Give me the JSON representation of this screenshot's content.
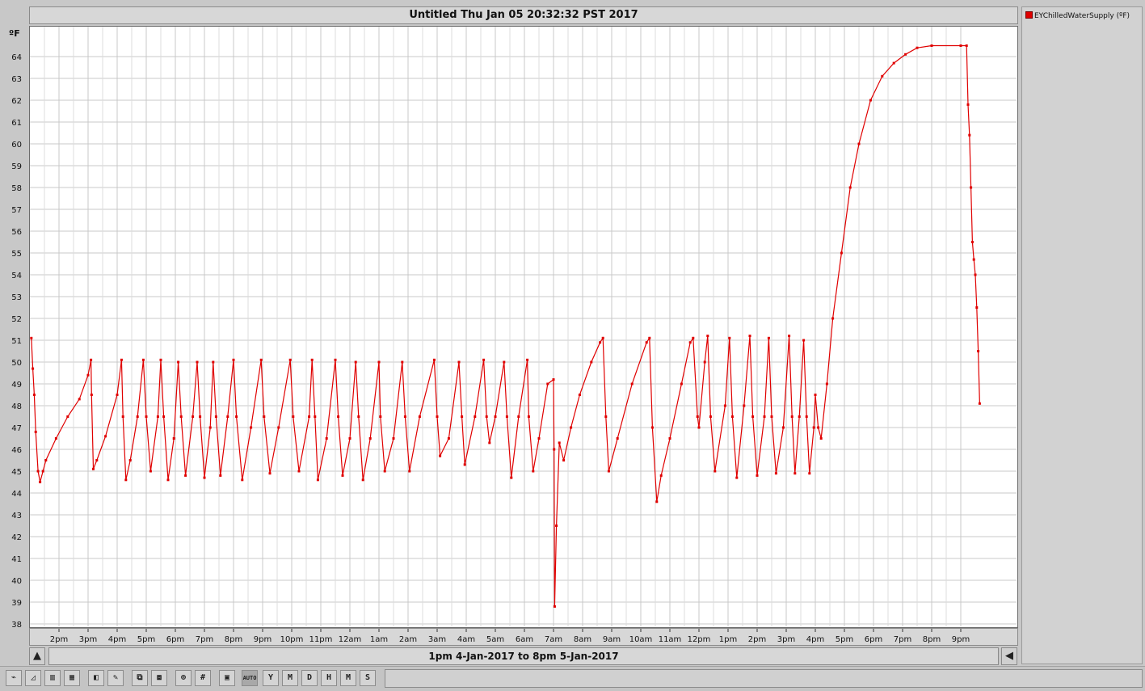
{
  "window": {
    "title": "Untitled Thu Jan 05 20:32:32 PST 2017"
  },
  "range_label": "1pm 4-Jan-2017 to 8pm 5-Jan-2017",
  "toolbar": {
    "buttons": [
      {
        "name": "line-chart-icon",
        "glyph": "⌁"
      },
      {
        "name": "area-chart-icon",
        "glyph": "◿"
      },
      {
        "name": "bar-chart-icon",
        "glyph": "▥"
      },
      {
        "name": "stacked-bar-icon",
        "glyph": "▦"
      },
      {
        "name": "cube-3d-icon",
        "glyph": "◧"
      },
      {
        "name": "brush-icon",
        "glyph": "✎"
      },
      {
        "name": "copy-icon",
        "glyph": "⧉"
      },
      {
        "name": "paste-icon",
        "glyph": "⧈"
      },
      {
        "name": "zoom-icon",
        "glyph": "⊕"
      },
      {
        "name": "grid-icon",
        "glyph": "#"
      },
      {
        "name": "save-icon",
        "glyph": "▣"
      },
      {
        "name": "auto-button",
        "glyph": "AUTO"
      },
      {
        "name": "year-button",
        "glyph": "Y"
      },
      {
        "name": "month-button",
        "glyph": "M"
      },
      {
        "name": "day-button",
        "glyph": "D"
      },
      {
        "name": "hour-button",
        "glyph": "H"
      },
      {
        "name": "minute-button",
        "glyph": "M"
      },
      {
        "name": "second-button",
        "glyph": "S"
      }
    ]
  },
  "colors": {
    "series": "#e00000",
    "grid": "#c8c8c8"
  },
  "chart_data": {
    "type": "line",
    "unit_label": "ºF",
    "title": "Untitled Thu Jan 05 20:32:32 PST 2017",
    "ylim": [
      38,
      64
    ],
    "yticks": [
      38,
      39,
      40,
      41,
      42,
      43,
      44,
      45,
      46,
      47,
      48,
      49,
      50,
      51,
      52,
      53,
      54,
      55,
      56,
      57,
      58,
      59,
      60,
      61,
      62,
      63,
      64
    ],
    "x_tick_hours": [
      14,
      15,
      16,
      17,
      18,
      19,
      20,
      21,
      22,
      23,
      24,
      25,
      26,
      27,
      28,
      29,
      30,
      31,
      32,
      33,
      34,
      35,
      36,
      37,
      38,
      39,
      40,
      41,
      42,
      43,
      44,
      45
    ],
    "x_tick_labels": [
      "2pm",
      "3pm",
      "4pm",
      "5pm",
      "6pm",
      "7pm",
      "8pm",
      "9pm",
      "10pm",
      "11pm",
      "12am",
      "1am",
      "2am",
      "3am",
      "4am",
      "5am",
      "6am",
      "7am",
      "8am",
      "9am",
      "10am",
      "11am",
      "12pm",
      "1pm",
      "2pm",
      "3pm",
      "4pm",
      "5pm",
      "6pm",
      "7pm",
      "8pm",
      "9pm"
    ],
    "xlim_hours": [
      13.0,
      47.0
    ],
    "grid": true,
    "legend": "right panel",
    "series": [
      {
        "name": "EYChilledWaterSupply (ºF)",
        "points": [
          [
            13.05,
            51.1
          ],
          [
            13.1,
            49.7
          ],
          [
            13.15,
            48.5
          ],
          [
            13.2,
            46.8
          ],
          [
            13.28,
            45.0
          ],
          [
            13.35,
            44.5
          ],
          [
            13.45,
            45.0
          ],
          [
            13.55,
            45.5
          ],
          [
            13.9,
            46.5
          ],
          [
            14.3,
            47.5
          ],
          [
            14.7,
            48.3
          ],
          [
            15.0,
            49.4
          ],
          [
            15.1,
            50.1
          ],
          [
            15.12,
            48.5
          ],
          [
            15.18,
            45.1
          ],
          [
            15.3,
            45.5
          ],
          [
            15.6,
            46.6
          ],
          [
            16.0,
            48.5
          ],
          [
            16.15,
            50.1
          ],
          [
            16.2,
            47.5
          ],
          [
            16.3,
            44.6
          ],
          [
            16.45,
            45.5
          ],
          [
            16.7,
            47.5
          ],
          [
            16.9,
            50.1
          ],
          [
            17.0,
            47.5
          ],
          [
            17.15,
            45.0
          ],
          [
            17.4,
            47.5
          ],
          [
            17.5,
            50.1
          ],
          [
            17.6,
            47.5
          ],
          [
            17.75,
            44.6
          ],
          [
            17.95,
            46.5
          ],
          [
            18.1,
            50.0
          ],
          [
            18.2,
            47.5
          ],
          [
            18.35,
            44.8
          ],
          [
            18.6,
            47.5
          ],
          [
            18.75,
            50.0
          ],
          [
            18.85,
            47.5
          ],
          [
            19.0,
            44.7
          ],
          [
            19.2,
            47.0
          ],
          [
            19.3,
            50.0
          ],
          [
            19.4,
            47.5
          ],
          [
            19.55,
            44.8
          ],
          [
            19.8,
            47.5
          ],
          [
            20.0,
            50.1
          ],
          [
            20.1,
            47.5
          ],
          [
            20.3,
            44.6
          ],
          [
            20.6,
            47.0
          ],
          [
            20.95,
            50.1
          ],
          [
            21.05,
            47.5
          ],
          [
            21.25,
            44.9
          ],
          [
            21.55,
            47.0
          ],
          [
            21.95,
            50.1
          ],
          [
            22.05,
            47.5
          ],
          [
            22.25,
            45.0
          ],
          [
            22.6,
            47.5
          ],
          [
            22.7,
            50.1
          ],
          [
            22.8,
            47.5
          ],
          [
            22.9,
            44.6
          ],
          [
            23.2,
            46.5
          ],
          [
            23.5,
            50.1
          ],
          [
            23.6,
            47.5
          ],
          [
            23.75,
            44.8
          ],
          [
            24.0,
            46.5
          ],
          [
            24.2,
            50.0
          ],
          [
            24.3,
            47.5
          ],
          [
            24.45,
            44.6
          ],
          [
            24.7,
            46.5
          ],
          [
            25.0,
            50.0
          ],
          [
            25.05,
            47.5
          ],
          [
            25.2,
            45.0
          ],
          [
            25.5,
            46.5
          ],
          [
            25.8,
            50.0
          ],
          [
            25.9,
            47.5
          ],
          [
            26.05,
            45.0
          ],
          [
            26.4,
            47.5
          ],
          [
            26.9,
            50.1
          ],
          [
            27.0,
            47.5
          ],
          [
            27.1,
            45.7
          ],
          [
            27.4,
            46.5
          ],
          [
            27.75,
            50.0
          ],
          [
            27.85,
            47.5
          ],
          [
            27.95,
            45.3
          ],
          [
            28.3,
            47.5
          ],
          [
            28.6,
            50.1
          ],
          [
            28.7,
            47.5
          ],
          [
            28.8,
            46.3
          ],
          [
            29.0,
            47.5
          ],
          [
            29.3,
            50.0
          ],
          [
            29.4,
            47.5
          ],
          [
            29.55,
            44.7
          ],
          [
            29.8,
            47.5
          ],
          [
            30.1,
            50.1
          ],
          [
            30.15,
            47.5
          ],
          [
            30.3,
            45.0
          ],
          [
            30.5,
            46.5
          ],
          [
            30.8,
            49.0
          ],
          [
            31.0,
            49.2
          ],
          [
            31.02,
            46.0
          ],
          [
            31.04,
            38.8
          ],
          [
            31.1,
            42.5
          ],
          [
            31.2,
            46.3
          ],
          [
            31.35,
            45.5
          ],
          [
            31.6,
            47.0
          ],
          [
            31.9,
            48.5
          ],
          [
            32.3,
            50.0
          ],
          [
            32.6,
            50.9
          ],
          [
            32.7,
            51.1
          ],
          [
            32.8,
            47.5
          ],
          [
            32.9,
            45.0
          ],
          [
            33.2,
            46.5
          ],
          [
            33.7,
            49.0
          ],
          [
            34.2,
            50.9
          ],
          [
            34.3,
            51.1
          ],
          [
            34.4,
            47.0
          ],
          [
            34.55,
            43.6
          ],
          [
            34.7,
            44.8
          ],
          [
            35.0,
            46.5
          ],
          [
            35.4,
            49.0
          ],
          [
            35.7,
            50.9
          ],
          [
            35.8,
            51.1
          ],
          [
            35.95,
            47.5
          ],
          [
            36.0,
            47.0
          ],
          [
            36.2,
            50.0
          ],
          [
            36.3,
            51.2
          ],
          [
            36.4,
            47.5
          ],
          [
            36.55,
            45.0
          ],
          [
            36.9,
            48.0
          ],
          [
            37.05,
            51.1
          ],
          [
            37.15,
            47.5
          ],
          [
            37.3,
            44.7
          ],
          [
            37.55,
            48.0
          ],
          [
            37.75,
            51.2
          ],
          [
            37.85,
            47.5
          ],
          [
            38.0,
            44.8
          ],
          [
            38.25,
            47.5
          ],
          [
            38.4,
            51.1
          ],
          [
            38.5,
            47.5
          ],
          [
            38.65,
            44.9
          ],
          [
            38.9,
            47.0
          ],
          [
            39.1,
            51.2
          ],
          [
            39.2,
            47.5
          ],
          [
            39.3,
            44.9
          ],
          [
            39.45,
            47.5
          ],
          [
            39.6,
            51.0
          ],
          [
            39.7,
            47.5
          ],
          [
            39.8,
            44.9
          ],
          [
            39.95,
            47.0
          ],
          [
            40.0,
            48.5
          ],
          [
            40.1,
            47.0
          ],
          [
            40.2,
            46.5
          ],
          [
            40.4,
            49.0
          ],
          [
            40.6,
            52.0
          ],
          [
            40.9,
            55.0
          ],
          [
            41.2,
            58.0
          ],
          [
            41.5,
            60.0
          ],
          [
            41.9,
            62.0
          ],
          [
            42.3,
            63.1
          ],
          [
            42.7,
            63.7
          ],
          [
            43.1,
            64.1
          ],
          [
            43.5,
            64.4
          ],
          [
            44.0,
            64.5
          ],
          [
            45.0,
            64.5
          ],
          [
            45.2,
            64.5
          ],
          [
            45.25,
            61.8
          ],
          [
            45.3,
            60.4
          ],
          [
            45.35,
            58.0
          ],
          [
            45.4,
            55.5
          ],
          [
            45.45,
            54.7
          ],
          [
            45.5,
            54.0
          ],
          [
            45.55,
            52.5
          ],
          [
            45.6,
            50.5
          ],
          [
            45.65,
            48.1
          ]
        ]
      }
    ]
  }
}
